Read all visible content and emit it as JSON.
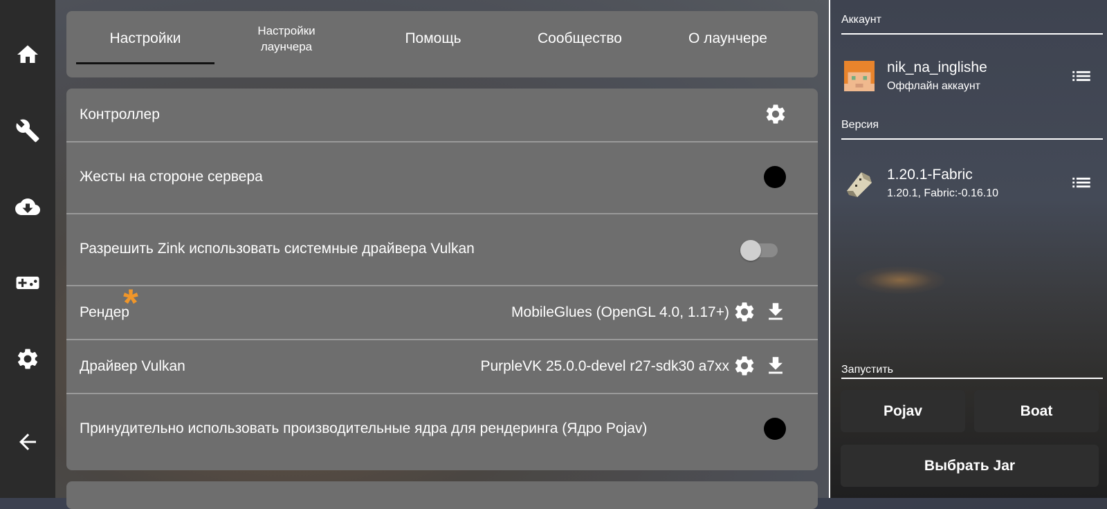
{
  "tabs": [
    {
      "label": "Настройки",
      "active": true
    },
    {
      "label": "Настройки лаунчера"
    },
    {
      "label": "Помощь"
    },
    {
      "label": "Сообщество"
    },
    {
      "label": "О лаунчере"
    }
  ],
  "rail": {
    "icons": [
      "home-icon",
      "wrench-icon",
      "cloud-download-icon",
      "gamepad-icon",
      "gear-icon",
      "back-arrow-icon"
    ]
  },
  "settings": {
    "controller": {
      "label": "Контроллер"
    },
    "server_gestures": {
      "label": "Жесты на стороне сервера",
      "enabled": true
    },
    "zink_vulkan": {
      "label": "Разрешить Zink использовать системные драйвера Vulkan",
      "enabled": false
    },
    "renderer": {
      "label": "Рендер",
      "value": "MobileGlues (OpenGL 4.0, 1.17+)",
      "marker": "*"
    },
    "vulkan_driver": {
      "label": "Драйвер Vulkan",
      "value": "PurpleVK 25.0.0-devel r27-sdk30 a7xx"
    },
    "perf_cores": {
      "label": "Принудительно использовать производительные ядра для рендеринга (Ядро Pojav)",
      "enabled": true
    }
  },
  "sidebar": {
    "account_title": "Аккаунт",
    "account_name": "nik_na_inglishe",
    "account_type": "Оффлайн аккаунт",
    "version_title": "Версия",
    "version_name": "1.20.1-Fabric",
    "version_detail": "1.20.1, Fabric:-0.16.10",
    "launch_title": "Запустить",
    "launch_pojav": "Pojav",
    "launch_boat": "Boat",
    "select_jar": "Выбрать Jar"
  },
  "colors": {
    "accent_star": "#f0962a",
    "panel": "#6e6e6e",
    "rail": "#2b2b2b",
    "button": "#2e2e2e"
  }
}
